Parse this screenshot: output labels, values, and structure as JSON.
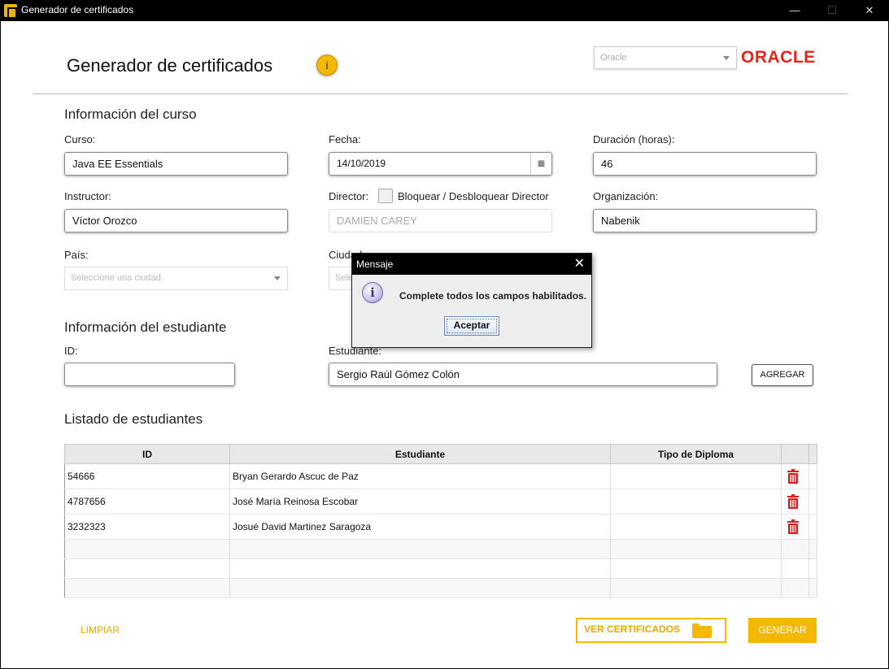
{
  "window": {
    "title": "Generador de certificados",
    "minimize": "—",
    "maximize": "☐",
    "close": "✕"
  },
  "header": {
    "title": "Generador de certificados",
    "info_icon": "info-icon",
    "brand_combo": {
      "placeholder": "Oracle"
    },
    "logo_text": "ORACLE"
  },
  "course": {
    "section_title": "Información del curso",
    "curso": {
      "label": "Curso:",
      "value": "Java EE Essentials"
    },
    "fecha": {
      "label": "Fecha:",
      "value": "14/10/2019"
    },
    "duracion": {
      "label": "Duración (horas):",
      "value": "46"
    },
    "instructor": {
      "label": "Instructor:",
      "value": "Víctor Orozco"
    },
    "director": {
      "label": "Director:",
      "checkbox_label": "Bloquear / Desbloquear Director",
      "value": "DAMIEN CAREY"
    },
    "organizacion": {
      "label": "Organización:",
      "value": "Nabenik"
    },
    "pais": {
      "label": "País:",
      "placeholder": "Seleccione una ciudad."
    },
    "ciudad": {
      "label": "Ciudad:",
      "placeholder": "Seleccione una ciudad."
    }
  },
  "student": {
    "section_title": "Información del estudiante",
    "id": {
      "label": "ID:",
      "value": ""
    },
    "estudiante": {
      "label": "Estudiante:",
      "value": "Sergio Raúl Gómez Colón"
    },
    "add_button": "AGREGAR"
  },
  "list": {
    "section_title": "Listado de estudiantes",
    "columns": [
      "ID",
      "Estudiante",
      "Tipo de Diploma"
    ],
    "rows": [
      {
        "id": "54666",
        "name": "Bryan Gerardo Ascuc de Paz",
        "diploma": ""
      },
      {
        "id": "4787656",
        "name": "José María Reinosa Escobar",
        "diploma": ""
      },
      {
        "id": "3232323",
        "name": "Josué David Martinez Saragoza",
        "diploma": ""
      }
    ]
  },
  "footer": {
    "clear_button": "LIMPIAR",
    "view_button": "VER CERTIFICADOS",
    "generate_button": "GENERAR"
  },
  "dialog": {
    "title": "Mensaje",
    "message": "Complete todos los campos habilitados.",
    "ok_button": "Aceptar",
    "icon_glyph": "i"
  },
  "colors": {
    "accent": "#f5b800",
    "oracle_red": "#e2271c",
    "delete_red": "#e21b1b"
  }
}
